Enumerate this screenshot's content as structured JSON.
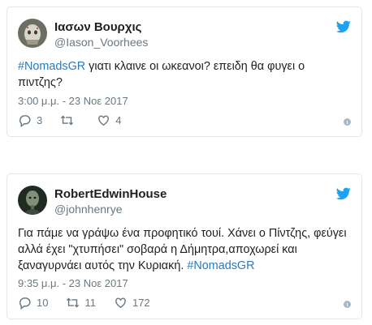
{
  "colors": {
    "accent": "#1da1f2",
    "hashtag": "#2b7bb9",
    "muted": "#697882",
    "border": "#e1e8ed",
    "text": "#1c2022"
  },
  "tweets": [
    {
      "name": "Ιασων Βουρχις",
      "handle": "@Iason_Voorhees",
      "text_parts": [
        "#NomadsGR",
        " γιατι κλαινε οι ωκεανοι? επειδη θα φυγει ο πιντζης?"
      ],
      "timestamp": "3:00 μ.μ. - 23 Νοε 2017",
      "replies": "3",
      "retweets": "",
      "likes": "4"
    },
    {
      "name": "RobertEdwinHouse",
      "handle": "@johnhenrye",
      "text_parts": [
        "Για πάμε να γράψω ένα προφητικό τουί. Χάνει ο Πίντζης, φεύγει αλλά έχει \"χτυπήσει\" σοβαρά η Δήμητρα,αποχωρεί και ξαναγυρνάει αυτός την Κυριακή. ",
        "#NomadsGR"
      ],
      "timestamp": "9:35 μ.μ. - 23 Νοε 2017",
      "replies": "10",
      "retweets": "11",
      "likes": "172"
    }
  ],
  "icons": {
    "brand": "twitter-bird-icon",
    "reply": "reply-icon",
    "retweet": "retweet-icon",
    "like": "heart-icon",
    "info": "info-icon"
  }
}
